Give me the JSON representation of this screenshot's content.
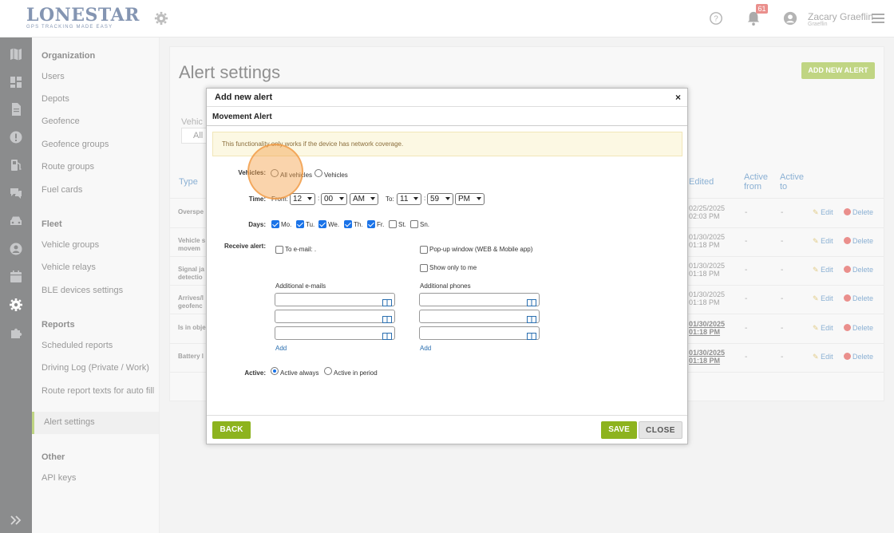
{
  "header": {
    "logo_text": "LONESTAR",
    "logo_small": "TRACKING",
    "logo_tagline": "GPS TRACKING MADE EASY",
    "notification_count": "61",
    "user_name": "Zacary Graeflin",
    "user_sub": "Graeflin"
  },
  "sidebar": {
    "sections": [
      {
        "title": "Organization",
        "items": [
          "Users",
          "Depots",
          "Geofence",
          "Geofence groups",
          "Route groups",
          "Fuel cards"
        ]
      },
      {
        "title": "Fleet",
        "items": [
          "Vehicle groups",
          "Vehicle relays",
          "BLE devices settings"
        ]
      },
      {
        "title": "Reports",
        "items": [
          "Scheduled reports",
          "Driving Log (Private / Work)",
          "Route report texts for auto fill",
          "Alert settings"
        ]
      },
      {
        "title": "Other",
        "items": [
          "API keys"
        ]
      }
    ],
    "active_item": "Alert settings"
  },
  "page": {
    "title": "Alert settings",
    "add_button": "ADD NEW ALERT",
    "vehicle_filter_label": "Vehic",
    "vehicle_filter_value": "All",
    "columns": {
      "type": "Type",
      "edited": "Edited",
      "active_from": "Active from",
      "active_to": "Active to"
    },
    "rows": [
      {
        "type": "Overspe",
        "edited": "02/25/2025 02:03 PM",
        "from": "-",
        "to": "-",
        "bold": false
      },
      {
        "type": "Vehicle s movem",
        "edited": "01/30/2025 01:18 PM",
        "from": "-",
        "to": "-",
        "bold": false
      },
      {
        "type": "Signal ja detectio",
        "edited": "01/30/2025 01:18 PM",
        "from": "-",
        "to": "-",
        "bold": false
      },
      {
        "type": "Arrives/l geofenc",
        "edited": "01/30/2025 01:18 PM",
        "from": "-",
        "to": "-",
        "bold": false
      },
      {
        "type": "Is in obje",
        "edited": "01/30/2025 01:18 PM",
        "from": "-",
        "to": "-",
        "bold": true
      },
      {
        "type": "Battery l",
        "edited": "01/30/2025 01:18 PM",
        "from": "-",
        "to": "-",
        "bold": true
      }
    ],
    "edit_label": "Edit",
    "delete_label": "Delete"
  },
  "modal": {
    "title": "Add new alert",
    "close_symbol": "×",
    "subtitle": "Movement Alert",
    "notice": "This functionality only works if the device has network coverage.",
    "vehicles_label": "Vehicles:",
    "vehicles_options": [
      "All vehicles",
      "Vehicles"
    ],
    "time_label": "Time:",
    "from_label": "From:",
    "to_label": "To:",
    "from_hour": "12",
    "from_min": "00",
    "from_ampm": "AM",
    "to_hour": "11",
    "to_min": "59",
    "to_ampm": "PM",
    "colon": ":",
    "days_label": "Days:",
    "days": [
      {
        "label": "Mo.",
        "checked": true
      },
      {
        "label": "Tu.",
        "checked": true
      },
      {
        "label": "We.",
        "checked": true
      },
      {
        "label": "Th.",
        "checked": true
      },
      {
        "label": "Fr.",
        "checked": true
      },
      {
        "label": "St.",
        "checked": false
      },
      {
        "label": "Sn.",
        "checked": false
      }
    ],
    "receive_label": "Receive alert:",
    "email_option": "To e-mail: .",
    "popup_option": "Pop-up window (WEB & Mobile app)",
    "show_only_me": "Show only to me",
    "additional_emails": "Additional e-mails",
    "additional_phones": "Additional phones",
    "add_link": "Add",
    "active_label": "Active:",
    "active_options": [
      "Active always",
      "Active in period"
    ],
    "back_button": "BACK",
    "save_button": "SAVE",
    "close_button": "CLOSE"
  },
  "colors": {
    "accent": "#8db31e",
    "link": "#2a6fb0",
    "brand": "#1f3f73"
  }
}
